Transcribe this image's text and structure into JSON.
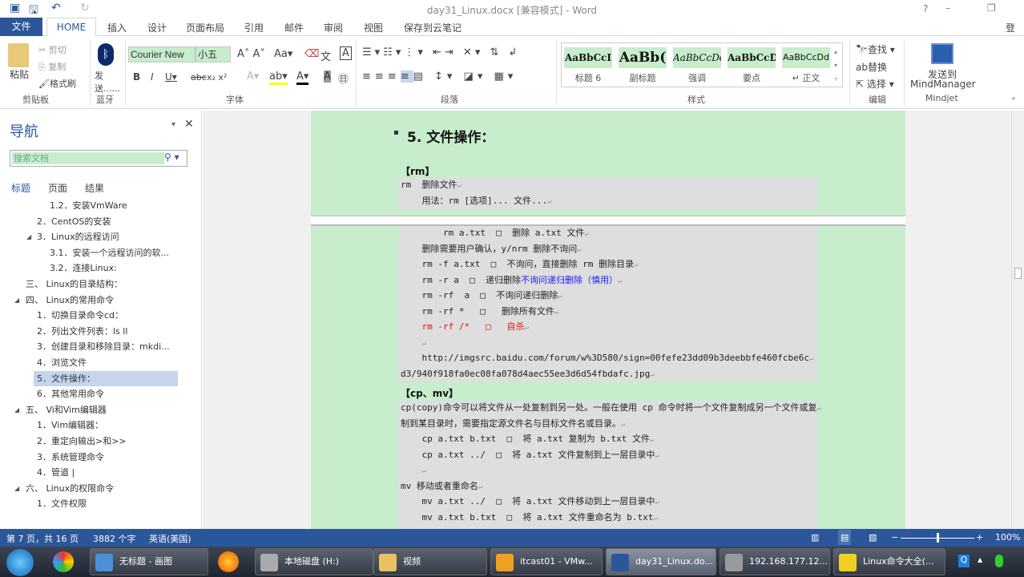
{
  "window": {
    "title": "day31_Linux.docx [兼容模式] - Word",
    "help": "?",
    "login": "登录"
  },
  "tabs": {
    "file": "文件",
    "items": [
      "HOME",
      "插入",
      "设计",
      "页面布局",
      "引用",
      "邮件",
      "审阅",
      "视图",
      "保存到云笔记"
    ]
  },
  "ribbon": {
    "clipboard": {
      "paste": "粘贴",
      "cut": "剪切",
      "copy": "复制",
      "format_painter": "格式刷",
      "label": "剪贴板"
    },
    "bluetooth": {
      "send": "发送......",
      "label": "蓝牙"
    },
    "font": {
      "name": "Courier New",
      "size": "小五",
      "label": "字体"
    },
    "paragraph": {
      "label": "段落"
    },
    "styles": {
      "items": [
        {
          "preview": "AaBbCcI",
          "name": "标题 6"
        },
        {
          "preview": "AaBb(",
          "name": "副标题"
        },
        {
          "preview": "AaBbCcDd",
          "name": "强调"
        },
        {
          "preview": "AaBbCcD",
          "name": "要点"
        },
        {
          "preview": "AaBbCcDd",
          "name": "↵ 正文"
        }
      ],
      "label": "样式"
    },
    "editing": {
      "find": "查找",
      "replace": "替换",
      "select": "选择",
      "label": "编辑"
    },
    "mindjet": {
      "send": "发送到",
      "app": "MindManager",
      "label": "Mindjet"
    }
  },
  "nav": {
    "title": "导航",
    "search_placeholder": "搜索文档",
    "tabs": [
      "标题",
      "页面",
      "结果"
    ],
    "items": [
      {
        "text": "1.2．安装VmWare",
        "level": 3
      },
      {
        "text": "2．CentOS的安装",
        "level": 2
      },
      {
        "text": "3．Linux的远程访问",
        "level": 2,
        "expanded": true
      },
      {
        "text": "3.1．安装一个远程访问的软...",
        "level": 3
      },
      {
        "text": "3.2．连接Linux:",
        "level": 3
      },
      {
        "text": "三、 Linux的目录结构：",
        "level": 1
      },
      {
        "text": "四、 Linux的常用命令",
        "level": 1,
        "expanded": true
      },
      {
        "text": "1．切换目录命令cd：",
        "level": 2
      },
      {
        "text": "2．列出文件列表：ls ll",
        "level": 2
      },
      {
        "text": "3．创建目录和移除目录：mkdi...",
        "level": 2
      },
      {
        "text": "4．浏览文件",
        "level": 2
      },
      {
        "text": "5．文件操作：",
        "level": 2,
        "selected": true
      },
      {
        "text": "6．其他常用命令",
        "level": 2
      },
      {
        "text": "五、 Vi和Vim编辑器",
        "level": 1,
        "expanded": true
      },
      {
        "text": "1．Vim编辑器：",
        "level": 2
      },
      {
        "text": "2．重定向输出>和>>",
        "level": 2
      },
      {
        "text": "3．系统管理命令",
        "level": 2
      },
      {
        "text": "4．管道 |",
        "level": 2
      },
      {
        "text": "六、 Linux的权限命令",
        "level": 1,
        "expanded": true
      },
      {
        "text": "1．文件权限",
        "level": 2
      }
    ]
  },
  "document": {
    "heading": "5.  文件操作：",
    "rm_title": "【rm】",
    "page1_lines": [
      [
        {
          "t": "rm  删除文件"
        }
      ],
      [
        {
          "t": "    用法：rm [选项]... 文件..."
        }
      ]
    ],
    "page2_lines": [
      [
        {
          "t": "        rm a.txt  □  删除 a.txt 文件"
        }
      ],
      [
        {
          "t": "    删除需要用户确认，y/nrm 删除不询问"
        }
      ],
      [
        {
          "t": "    rm -f a.txt  □  不询问，直接删除 rm 删除目录"
        }
      ],
      [
        {
          "t": "    rm -r a  □  递归删除"
        },
        {
          "t": "不询问递归删除（慎用）",
          "c": "#1a1aff"
        }
      ],
      [
        {
          "t": "    rm -rf  a  □  不询问递归删除"
        }
      ],
      [
        {
          "t": "    rm -rf *   □   删除所有文件"
        }
      ],
      [
        {
          "t": "    rm -rf /*   □   自杀",
          "c": "#e01010"
        }
      ],
      [
        {
          "t": "    "
        }
      ],
      [
        {
          "t": "    http://imgsrc.baidu.com/forum/w%3D580/sign=00fefe23dd09b3deebbfe460fcbe6c"
        }
      ],
      [
        {
          "t": "d3/940f918fa0ec08fa078d4aec55ee3d6d54fbdafc.jpg"
        }
      ]
    ],
    "cpmv_title": "【cp、mv】",
    "page2b_lines": [
      [
        {
          "t": "cp(copy)命令可以将文件从一处复制到另一处。一般在使用 cp 命令时将一个文件复制成另一个文件或复"
        }
      ],
      [
        {
          "t": "制到某目录时，需要指定源文件名与目标文件名或目录。"
        }
      ],
      [
        {
          "t": "    cp a.txt b.txt  □  将 a.txt 复制为 b.txt 文件"
        }
      ],
      [
        {
          "t": "    cp a.txt ../  □  将 a.txt 文件复制到上一层目录中"
        }
      ],
      [
        {
          "t": "    "
        }
      ],
      [
        {
          "t": "mv 移动或者重命名"
        }
      ],
      [
        {
          "t": "    mv a.txt ../  □  将 a.txt 文件移动到上一层目录中"
        }
      ],
      [
        {
          "t": "    mv a.txt b.txt  □  将 a.txt 文件重命名为 b.txt"
        }
      ]
    ]
  },
  "status": {
    "page": "第 7 页，共 16 页",
    "words": "3882 个字",
    "lang": "英语(美国)",
    "zoom": "100%",
    "zoom_level": 100
  },
  "taskbar": {
    "items": [
      {
        "label": "无标题 - 画图",
        "color": "#4a90d9"
      },
      {
        "label": "本地磁盘 (H:)",
        "color": "#aaa"
      },
      {
        "label": "视频",
        "color": "#e8c060"
      },
      {
        "label": "itcast01 - VMw...",
        "color": "#f0a020"
      },
      {
        "label": "day31_Linux.do...",
        "color": "#2b579a",
        "active": true
      },
      {
        "label": "192.168.177.12...",
        "color": "#999"
      },
      {
        "label": "Linux命令大全(...",
        "color": "#f0d020"
      }
    ]
  },
  "colors": {
    "accent": "#2b579a",
    "doc_bg": "#c7edcc",
    "code_bg": "#dedede"
  }
}
